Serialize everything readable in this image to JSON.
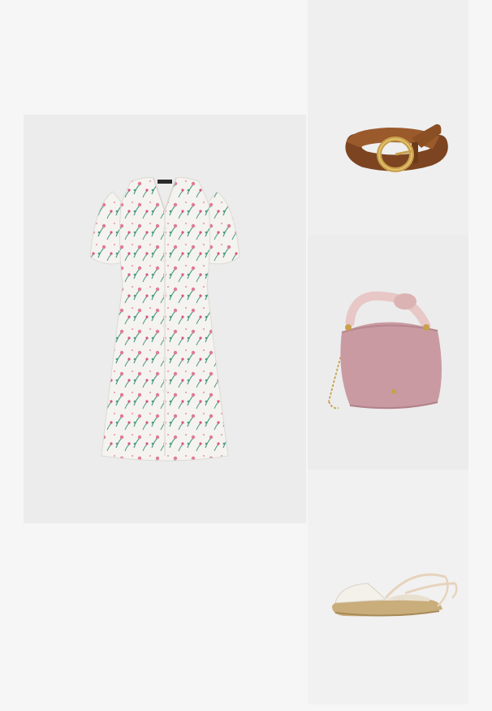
{
  "outfit": {
    "items": [
      {
        "id": "dress",
        "icon": "floral-dress-image"
      },
      {
        "id": "belt",
        "icon": "brown-leather-belt-image"
      },
      {
        "id": "bag",
        "icon": "pink-hobo-bag-image"
      },
      {
        "id": "shoe",
        "icon": "espadrille-sandal-image"
      }
    ]
  },
  "colors": {
    "page_background": "#f6f6f6",
    "dress_base": "#f4f3ef",
    "floral_pink": "#e07a95",
    "floral_green": "#4c9a83",
    "belt_brown": "#8a4f22",
    "buckle_gold": "#c9a04a",
    "bag_pink": "#c99aa2",
    "espadrille_jute": "#c9ad7a"
  }
}
